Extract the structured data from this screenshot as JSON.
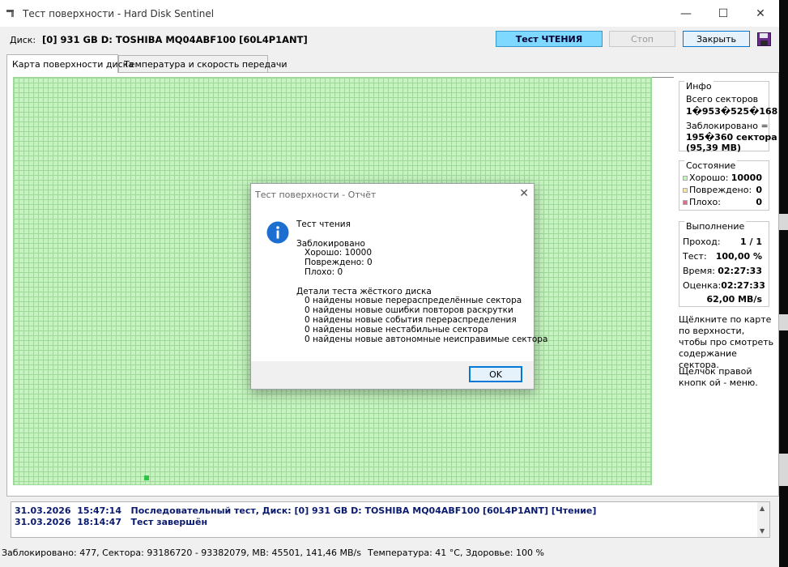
{
  "window": {
    "title": "Тест поверхности - Hard Disk Sentinel"
  },
  "toolbar": {
    "disk_label": "Диск:",
    "disk_name": "[0] 931 GB D: TOSHIBA MQ04ABF100 [60L4P1ANT]",
    "test_button": "Тест ЧТЕНИЯ",
    "stop_button": "Стоп",
    "close_button": "Закрыть"
  },
  "tabs": [
    {
      "label": "Карта поверхности диска"
    },
    {
      "label": "Температура и скорость передачи"
    }
  ],
  "info": {
    "title": "Инфо",
    "total_label": "Всего секторов",
    "total_value": "1�953�525�168",
    "blocked_line1": "Заблокировано =",
    "blocked_line2": "195�360 сектора",
    "blocked_line3": "(95,39 MB)"
  },
  "state": {
    "title": "Состояние",
    "good_label": "Хорошо:",
    "good_value": "10000",
    "damaged_label": "Повреждено:",
    "damaged_value": "0",
    "bad_label": "Плохо:",
    "bad_value": "0",
    "good_color": "#c6f4c0",
    "damaged_color": "#f5e6a0",
    "bad_color": "#e06c8c"
  },
  "progress": {
    "title": "Выполнение",
    "pass_label": "Проход:",
    "pass_value": "1 / 1",
    "test_label": "Тест:",
    "test_value": "100,00 %",
    "time_label": "Время:",
    "time_value": "02:27:33",
    "estimate_label": "Оценка:",
    "estimate_value": "02:27:33",
    "speed_value": "62,00 MB/s"
  },
  "hints": {
    "left_click": "Щёлкните по карте по верхности, чтобы про смотреть содержание сектора.",
    "right_click": "Щелчок правой кнопк ой - меню."
  },
  "log": [
    {
      "date": "31.03.2026",
      "time": "15:47:14",
      "text": "Последовательный тест, Диск: [0] 931 GB D: TOSHIBA MQ04ABF100 [60L4P1ANT] [Чтение]"
    },
    {
      "date": "31.03.2026",
      "time": "18:14:47",
      "text": "Тест завершён"
    }
  ],
  "status": {
    "left": "Заблокировано: 477, Сектора: 93186720 - 93382079, MB: 45501, 141,46 MB/s",
    "right": "Температура: 41  °C, Здоровье: 100 %"
  },
  "dialog": {
    "title": "Тест поверхности - Отчёт",
    "message": "Тест чтения\n\nЗаблокировано\n   Хорошо: 10000\n   Повреждено: 0\n   Плохо: 0\n\nДетали теста жёсткого диска\n   0 найдены новые перераспределённые сектора\n   0 найдены новые ошибки повторов раскрутки\n   0 найдены новые события перераспределения\n   0 найдены новые нестабильные сектора\n   0 найдены новые автономные неисправимые сектора",
    "ok_button": "OK"
  },
  "colors": {
    "accent": "#0078d7",
    "test_button": "#7fd8ff",
    "surface_good": "#c6f4c0",
    "log_text": "#0a1a6e"
  }
}
